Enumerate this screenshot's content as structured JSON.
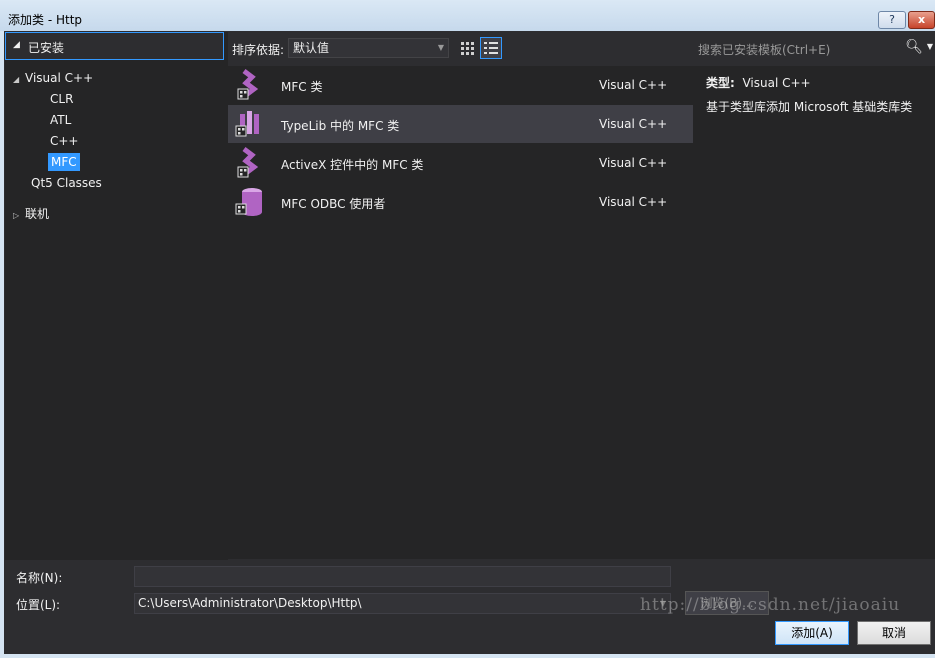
{
  "window": {
    "title": "添加类 - Http",
    "help_label": "?",
    "close_label": "x"
  },
  "left": {
    "installed_label": "已安装",
    "tree": {
      "visual_cpp": "Visual C++",
      "children": [
        "CLR",
        "ATL",
        "C++",
        "MFC"
      ],
      "qt5": "Qt5 Classes",
      "online": "联机"
    }
  },
  "toolbar": {
    "sort_label": "排序依据:",
    "sort_value": "默认值"
  },
  "templates": [
    {
      "name": "MFC 类",
      "lang": "Visual C++"
    },
    {
      "name": "TypeLib 中的 MFC 类",
      "lang": "Visual C++"
    },
    {
      "name": "ActiveX 控件中的 MFC 类",
      "lang": "Visual C++"
    },
    {
      "name": "MFC ODBC 使用者",
      "lang": "Visual C++"
    }
  ],
  "search": {
    "placeholder": "搜索已安装模板(Ctrl+E)"
  },
  "info": {
    "type_label": "类型:",
    "type_value": "Visual C++",
    "description": "基于类型库添加 Microsoft 基础类库类"
  },
  "form": {
    "name_label": "名称(N):",
    "name_value": "",
    "location_label": "位置(L):",
    "location_value": "C:\\Users\\Administrator\\Desktop\\Http\\",
    "browse_label": "浏览(B)...",
    "add_label": "添加(A)",
    "cancel_label": "取消"
  },
  "watermark": "http://blog.csdn.net/jiaoaiu",
  "colors": {
    "accent": "#3399ff",
    "icon_purple": "#b064c3",
    "background": "#2d2d30"
  }
}
